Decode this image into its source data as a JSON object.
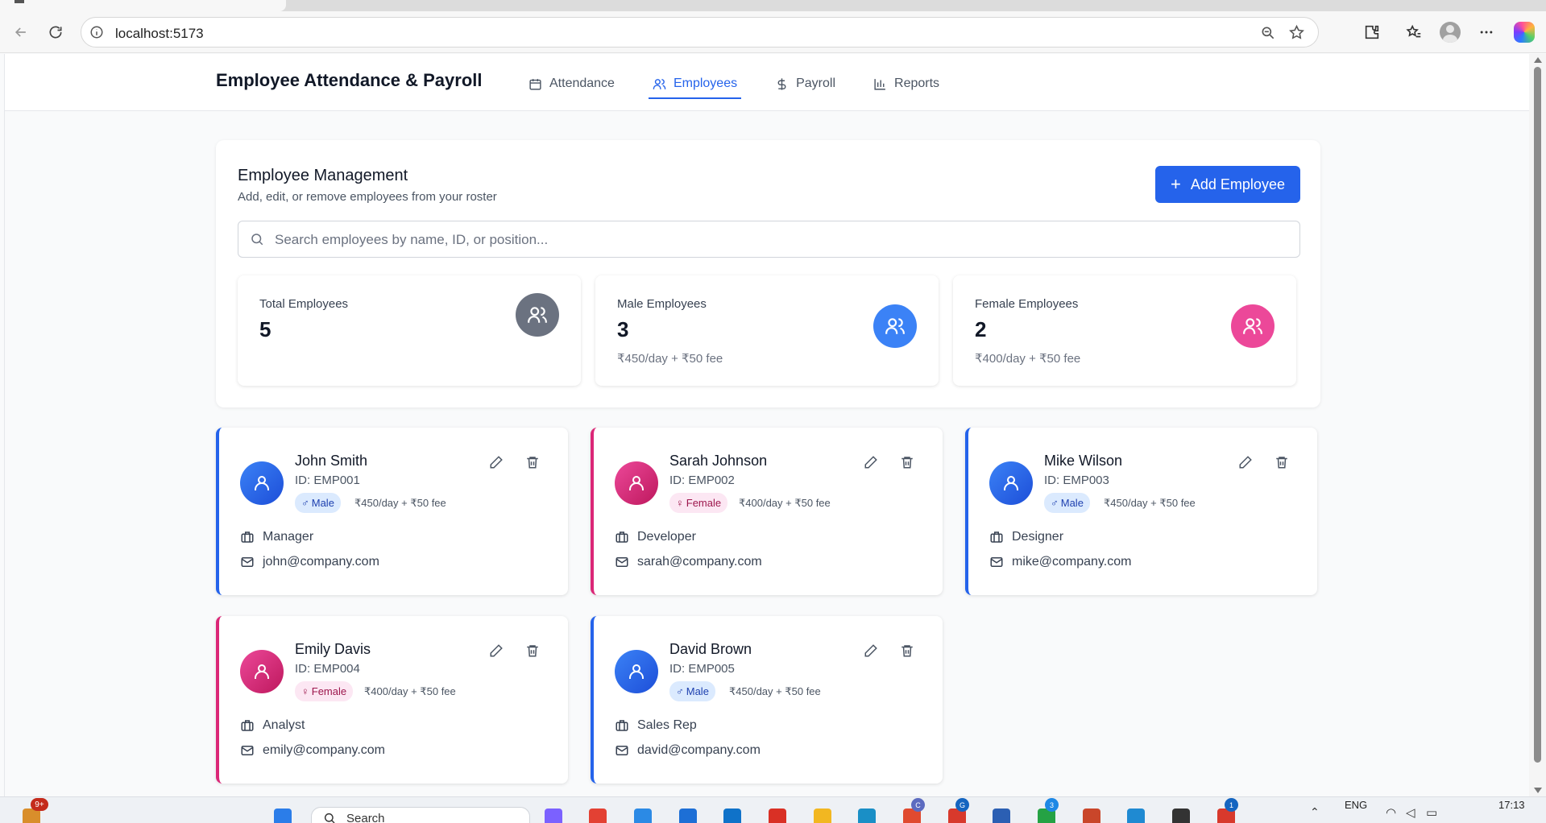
{
  "browser": {
    "url": "localhost:5173"
  },
  "app": {
    "title": "Employee Attendance & Payroll",
    "nav": [
      {
        "label": "Attendance",
        "icon": "calendar-icon",
        "active": false
      },
      {
        "label": "Employees",
        "icon": "users-icon",
        "active": true
      },
      {
        "label": "Payroll",
        "icon": "dollar-icon",
        "active": false
      },
      {
        "label": "Reports",
        "icon": "bar-chart-icon",
        "active": false
      }
    ]
  },
  "management": {
    "title": "Employee Management",
    "subtitle": "Add, edit, or remove employees from your roster",
    "add_button": "Add Employee",
    "search_placeholder": "Search employees by name, ID, or position..."
  },
  "stats": [
    {
      "label": "Total Employees",
      "value": "5",
      "fee": "",
      "color": "#6b7280"
    },
    {
      "label": "Male Employees",
      "value": "3",
      "fee": "₹450/day + ₹50 fee",
      "color": "#3b82f6"
    },
    {
      "label": "Female Employees",
      "value": "2",
      "fee": "₹400/day + ₹50 fee",
      "color": "#ec4899"
    }
  ],
  "employees": [
    {
      "name": "John Smith",
      "id": "ID: EMP001",
      "gender": "Male",
      "rate": "₹450/day + ₹50 fee",
      "position": "Manager",
      "email": "john@company.com"
    },
    {
      "name": "Sarah Johnson",
      "id": "ID: EMP002",
      "gender": "Female",
      "rate": "₹400/day + ₹50 fee",
      "position": "Developer",
      "email": "sarah@company.com"
    },
    {
      "name": "Mike Wilson",
      "id": "ID: EMP003",
      "gender": "Male",
      "rate": "₹450/day + ₹50 fee",
      "position": "Designer",
      "email": "mike@company.com"
    },
    {
      "name": "Emily Davis",
      "id": "ID: EMP004",
      "gender": "Female",
      "rate": "₹400/day + ₹50 fee",
      "position": "Analyst",
      "email": "emily@company.com"
    },
    {
      "name": "David Brown",
      "id": "ID: EMP005",
      "gender": "Male",
      "rate": "₹450/day + ₹50 fee",
      "position": "Sales Rep",
      "email": "david@company.com"
    }
  ],
  "colors": {
    "accent": "#2563eb",
    "male": "#2563eb",
    "female": "#db2777"
  },
  "taskbar": {
    "notification_count": "9+",
    "search_label": "Search",
    "language": "ENG",
    "time": "17:13",
    "badges": [
      "3",
      "G",
      "C",
      "1"
    ]
  }
}
